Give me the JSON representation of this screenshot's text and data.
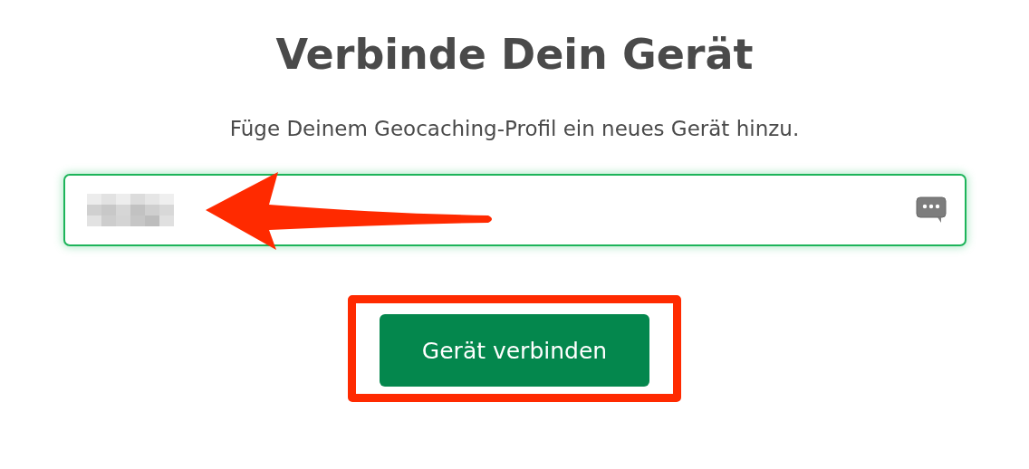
{
  "title": "Verbinde Dein Gerät",
  "subtitle": "Füge Deinem Geocaching-Profil ein neues Gerät hinzu.",
  "field": {
    "focused": true,
    "value_redacted": true,
    "pointed_at": true
  },
  "button": {
    "label": "Gerät verbinden",
    "highlighted": true
  }
}
